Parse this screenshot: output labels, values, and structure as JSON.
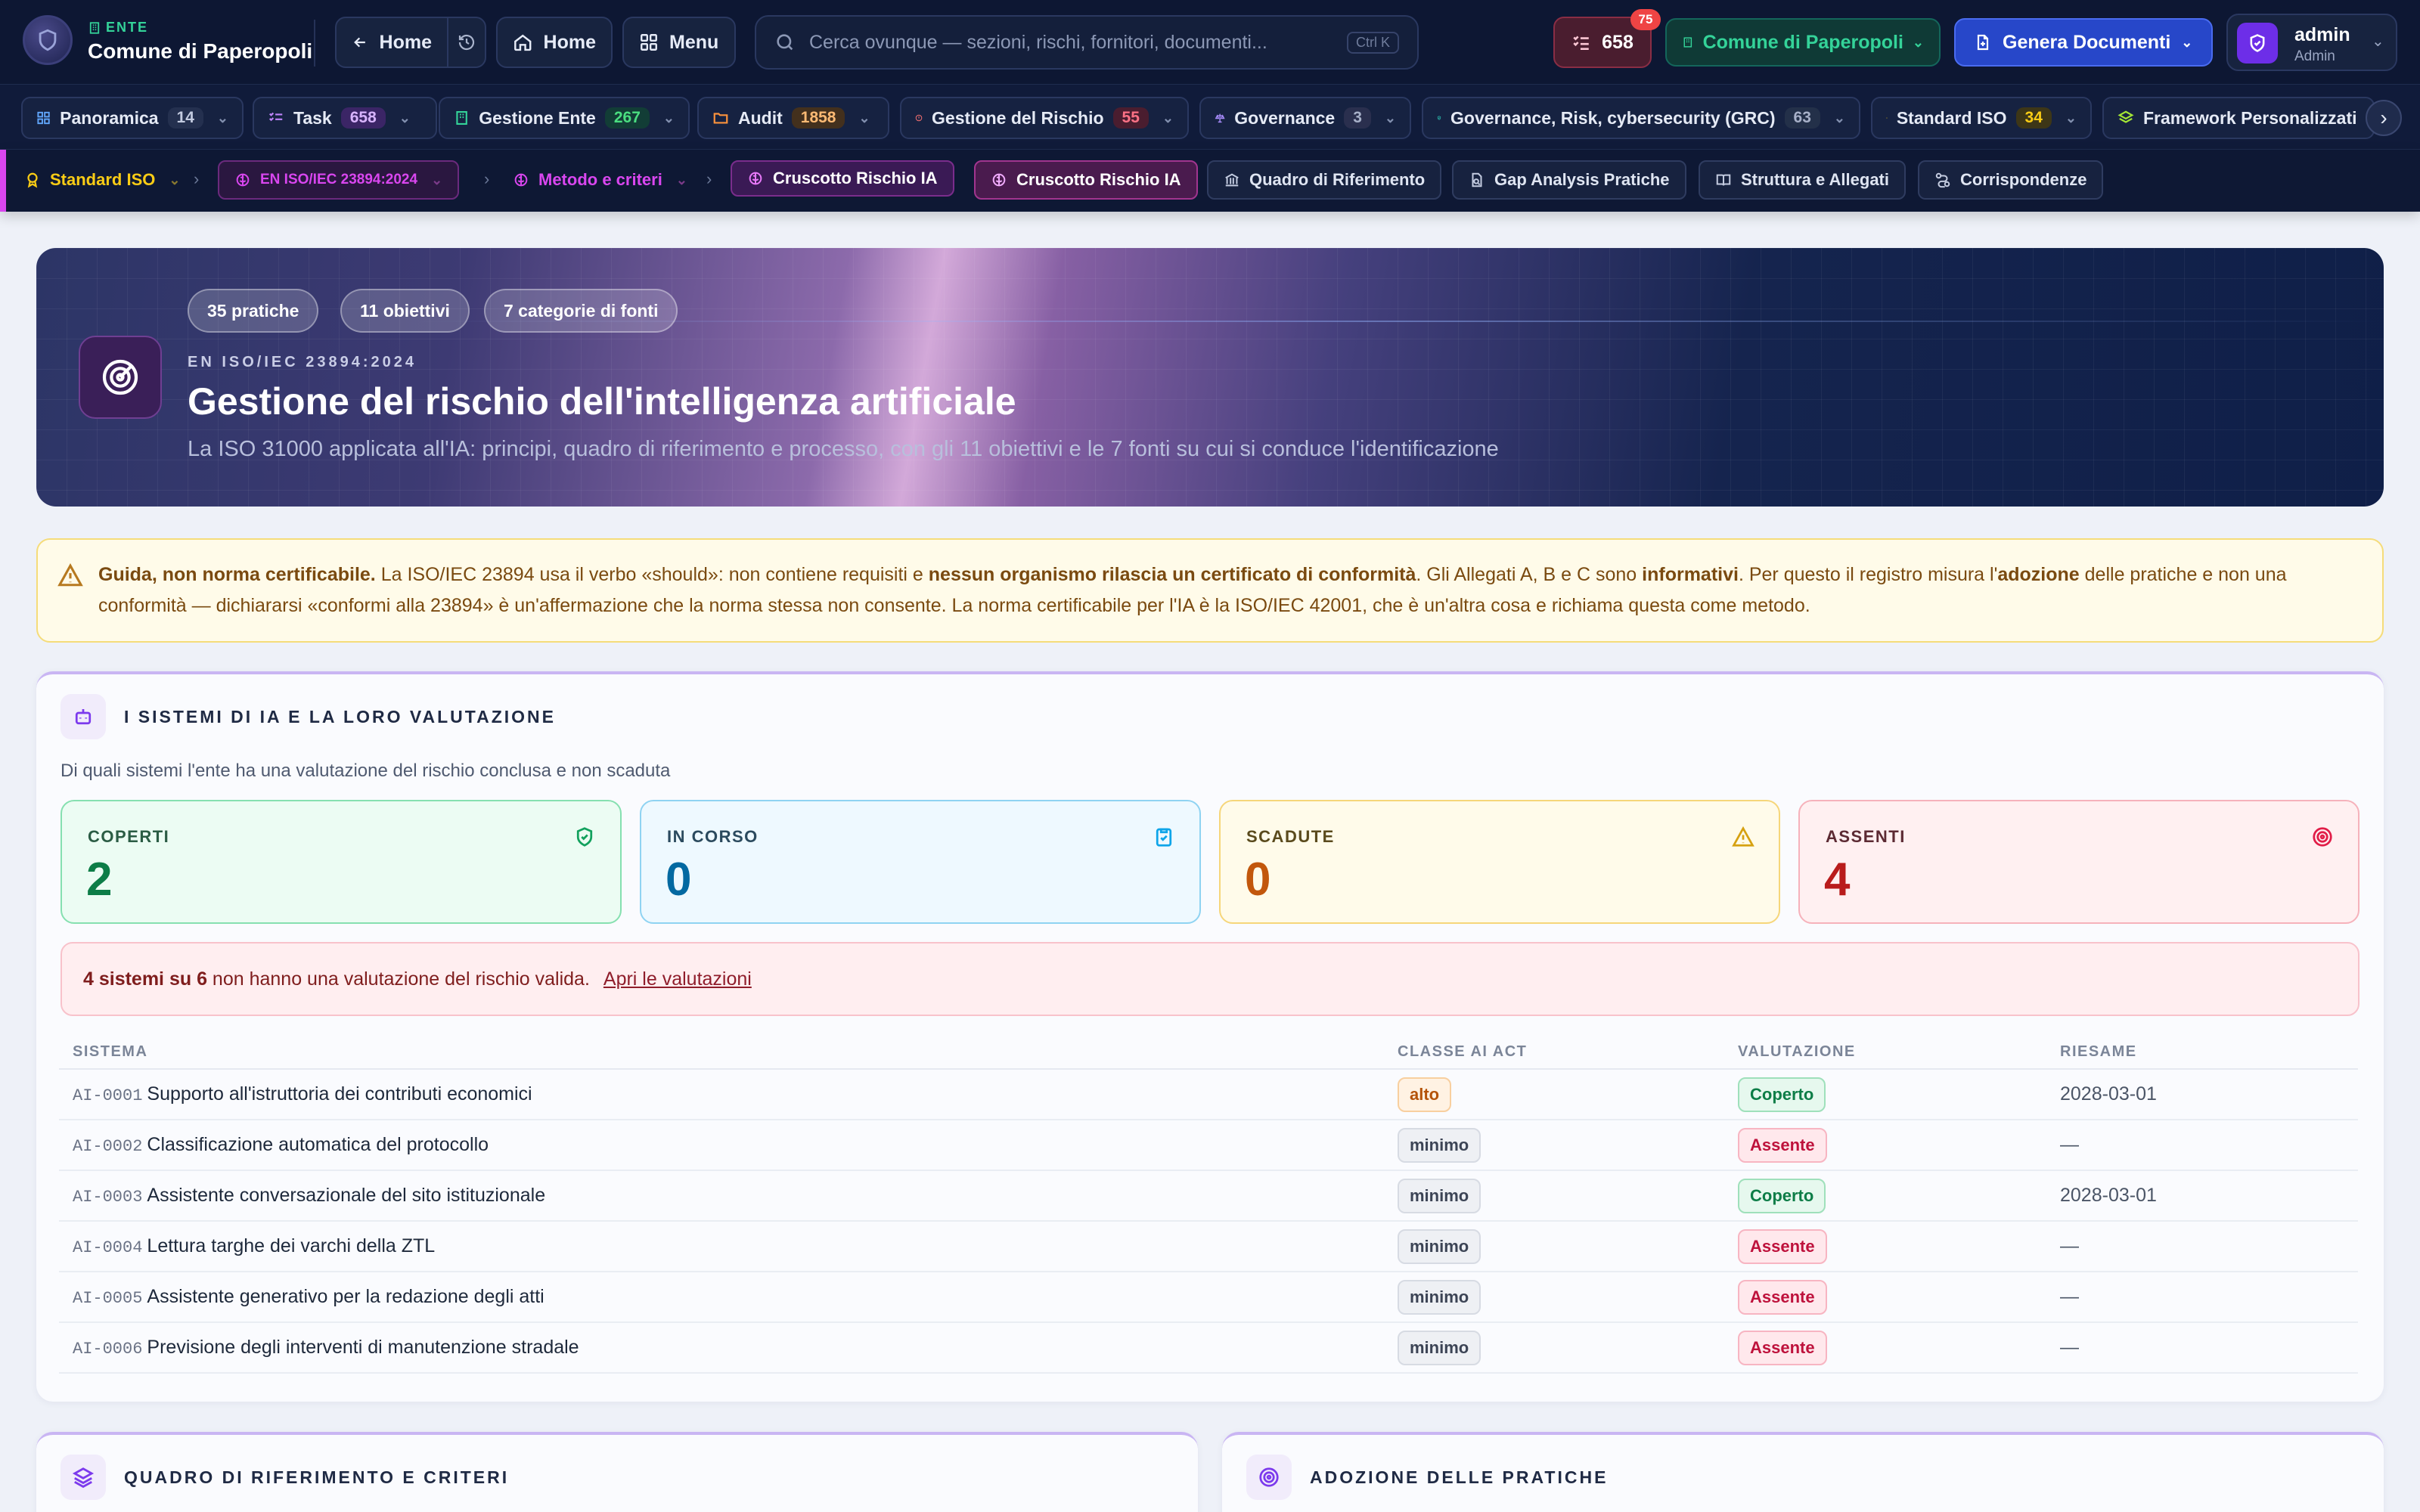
{
  "header": {
    "org_kicker": "ENTE",
    "org_name": "Comune di Paperopoli",
    "back_home": "Home",
    "home": "Home",
    "menu": "Menu",
    "search_placeholder": "Cerca ovunque — sezioni, rischi, fornitori, documenti...",
    "search_shortcut": "Ctrl K",
    "task_count": "658",
    "task_badge": "75",
    "entity_selector": "Comune di Paperopoli",
    "generate_docs": "Genera Documenti",
    "user_name": "admin",
    "user_role": "Admin"
  },
  "nav": [
    {
      "label": "Panoramica",
      "count": "14",
      "icon": "grid-icon"
    },
    {
      "label": "Task",
      "count": "658",
      "icon": "checklist-icon"
    },
    {
      "label": "Gestione Ente",
      "count": "267",
      "icon": "building-icon"
    },
    {
      "label": "Audit",
      "count": "1858",
      "icon": "folder-icon"
    },
    {
      "label": "Gestione del Rischio",
      "count": "55",
      "icon": "alert-circle-icon"
    },
    {
      "label": "Governance",
      "count": "3",
      "icon": "scales-icon"
    },
    {
      "label": "Governance, Risk, cybersecurity (GRC)",
      "count": "63",
      "icon": "shield-icon"
    },
    {
      "label": "Standard ISO",
      "count": "34",
      "icon": "award-icon"
    },
    {
      "label": "Framework Personalizzati",
      "count": "",
      "icon": "layers-icon"
    }
  ],
  "breadcrumb": {
    "l1": "Standard ISO",
    "l2": "EN ISO/IEC 23894:2024",
    "l3": "Metodo e criteri",
    "l4": "Cruscotto Rischio IA"
  },
  "subtabs": [
    "Cruscotto Rischio IA",
    "Quadro di Riferimento",
    "Gap Analysis Pratiche",
    "Struttura e Allegati",
    "Corrispondenze"
  ],
  "hero": {
    "chips": [
      "35 pratiche",
      "11 obiettivi",
      "7 categorie di fonti"
    ],
    "kicker": "EN ISO/IEC 23894:2024",
    "title": "Gestione del rischio dell'intelligenza artificiale",
    "subtitle": "La ISO 31000 applicata all'IA: principi, quadro di riferimento e processo, con gli 11 obiettivi e le 7 fonti su cui si conduce l'identificazione"
  },
  "notice": {
    "p1": "Guida, non norma certificabile.",
    "p2": " La ISO/IEC 23894 usa il verbo «should»: non contiene requisiti e ",
    "p3": "nessun organismo rilascia un certificato di conformità",
    "p4": ". Gli Allegati A, B e C sono ",
    "p5": "informativi",
    "p6": ". Per questo il registro misura l'",
    "p7": "adozione",
    "p8": " delle pratiche e non una conformità — dichiararsi «conformi alla 23894» è un'affermazione che la norma stessa non consente. La norma certificabile per l'IA è la ISO/IEC 42001, che è un'altra cosa e richiama questa come metodo."
  },
  "systems": {
    "title": "I SISTEMI DI IA E LA LORO VALUTAZIONE",
    "subtitle": "Di quali sistemi l'ente ha una valutazione del rischio conclusa e non scaduta",
    "stats": {
      "covered": {
        "label": "COPERTI",
        "value": "2"
      },
      "in_progress": {
        "label": "IN CORSO",
        "value": "0"
      },
      "expired": {
        "label": "SCADUTE",
        "value": "0"
      },
      "missing": {
        "label": "ASSENTI",
        "value": "4"
      }
    },
    "alert_bold": "4 sistemi su 6",
    "alert_text": " non hanno una valutazione del rischio valida.",
    "alert_link": "Apri le valutazioni",
    "columns": [
      "SISTEMA",
      "CLASSE AI ACT",
      "VALUTAZIONE",
      "RIESAME"
    ],
    "rows": [
      {
        "code": "AI-0001",
        "name": "Supporto all'istruttoria dei contributi economici",
        "class": "alto",
        "status": "Coperto",
        "review": "2028-03-01"
      },
      {
        "code": "AI-0002",
        "name": "Classificazione automatica del protocollo",
        "class": "minimo",
        "status": "Assente",
        "review": "—"
      },
      {
        "code": "AI-0003",
        "name": "Assistente conversazionale del sito istituzionale",
        "class": "minimo",
        "status": "Coperto",
        "review": "2028-03-01"
      },
      {
        "code": "AI-0004",
        "name": "Lettura targhe dei varchi della ZTL",
        "class": "minimo",
        "status": "Assente",
        "review": "—"
      },
      {
        "code": "AI-0005",
        "name": "Assistente generativo per la redazione degli atti",
        "class": "minimo",
        "status": "Assente",
        "review": "—"
      },
      {
        "code": "AI-0006",
        "name": "Previsione degli interventi di manutenzione stradale",
        "class": "minimo",
        "status": "Assente",
        "review": "—"
      }
    ]
  },
  "bottom_cards": {
    "left_title": "QUADRO DI RIFERIMENTO E CRITERI",
    "right_title": "ADOZIONE DELLE PRATICHE"
  }
}
